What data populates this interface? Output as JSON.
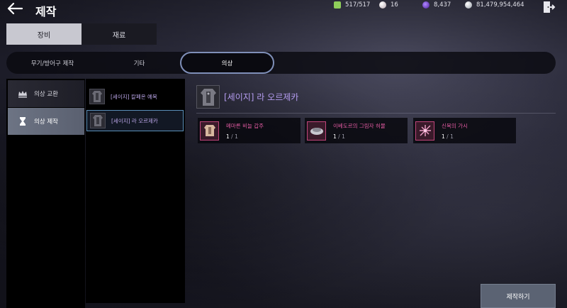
{
  "header": {
    "title": "제작",
    "currencies": [
      {
        "icon": "stamina-icon",
        "value": "517/517",
        "color": "#8fcf5a"
      },
      {
        "icon": "pearl-icon",
        "value": "16",
        "color": "#d8c8d0"
      },
      {
        "icon": "purple-gem-icon",
        "value": "8,437",
        "color": "#7a4ad8"
      },
      {
        "icon": "silver-coin-icon",
        "value": "81,479,954,464",
        "color": "#c0c4cc"
      }
    ]
  },
  "main_tabs": [
    {
      "label": "장비",
      "active": true
    },
    {
      "label": "재료",
      "active": false
    }
  ],
  "sub_tabs": [
    {
      "label": "무기/방어구 제작",
      "active": false
    },
    {
      "label": "기타",
      "active": false
    },
    {
      "label": "의상",
      "active": true
    }
  ],
  "categories": [
    {
      "label": "의상 교환",
      "icon": "crown-icon",
      "active": false
    },
    {
      "label": "의상 제작",
      "icon": "hourglass-icon",
      "active": true
    }
  ],
  "recipes": [
    {
      "label": "[세이지] 칼페온 예복",
      "selected": false
    },
    {
      "label": "[세이지] 라 오르제카",
      "selected": true
    }
  ],
  "detail": {
    "title": "[세이지] 라 오르제카",
    "materials": [
      {
        "name": "메마른 비늘 갑주",
        "have": "1",
        "need": "1",
        "icon": "armor-material-icon"
      },
      {
        "name": "이베도르의 그림자 허물",
        "have": "1",
        "need": "1",
        "icon": "shadow-shell-icon"
      },
      {
        "name": "신목의 가시",
        "have": "1",
        "need": "1",
        "icon": "thorn-icon"
      }
    ]
  },
  "craft_button": {
    "label": "제작하기"
  },
  "colors": {
    "accent_purple": "#b49cf0",
    "material_pink": "#e05aa0",
    "selection_blue": "#5a8fb8"
  }
}
